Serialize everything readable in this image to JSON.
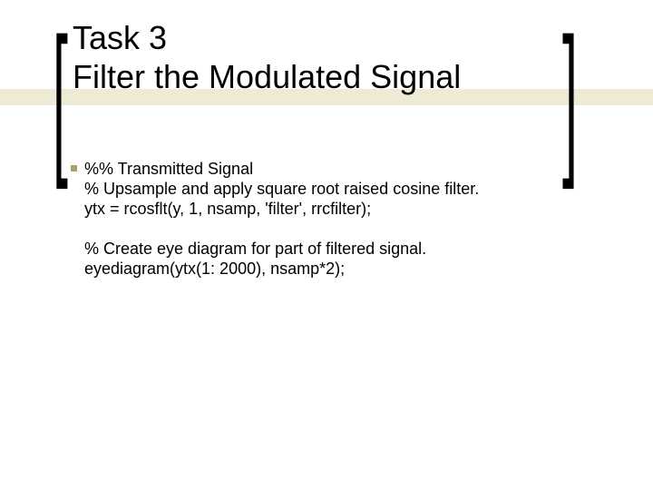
{
  "title": {
    "line1": "Task 3",
    "line2": "Filter the Modulated Signal"
  },
  "code": {
    "block1": {
      "l1": "%% Transmitted Signal",
      "l2": "% Upsample and apply square root raised cosine filter.",
      "l3": "ytx = rcosflt(y, 1, nsamp, 'filter', rrcfilter);"
    },
    "block2": {
      "l1": "% Create eye diagram for part of filtered signal.",
      "l2": "eyediagram(ytx(1: 2000), nsamp*2);"
    }
  }
}
